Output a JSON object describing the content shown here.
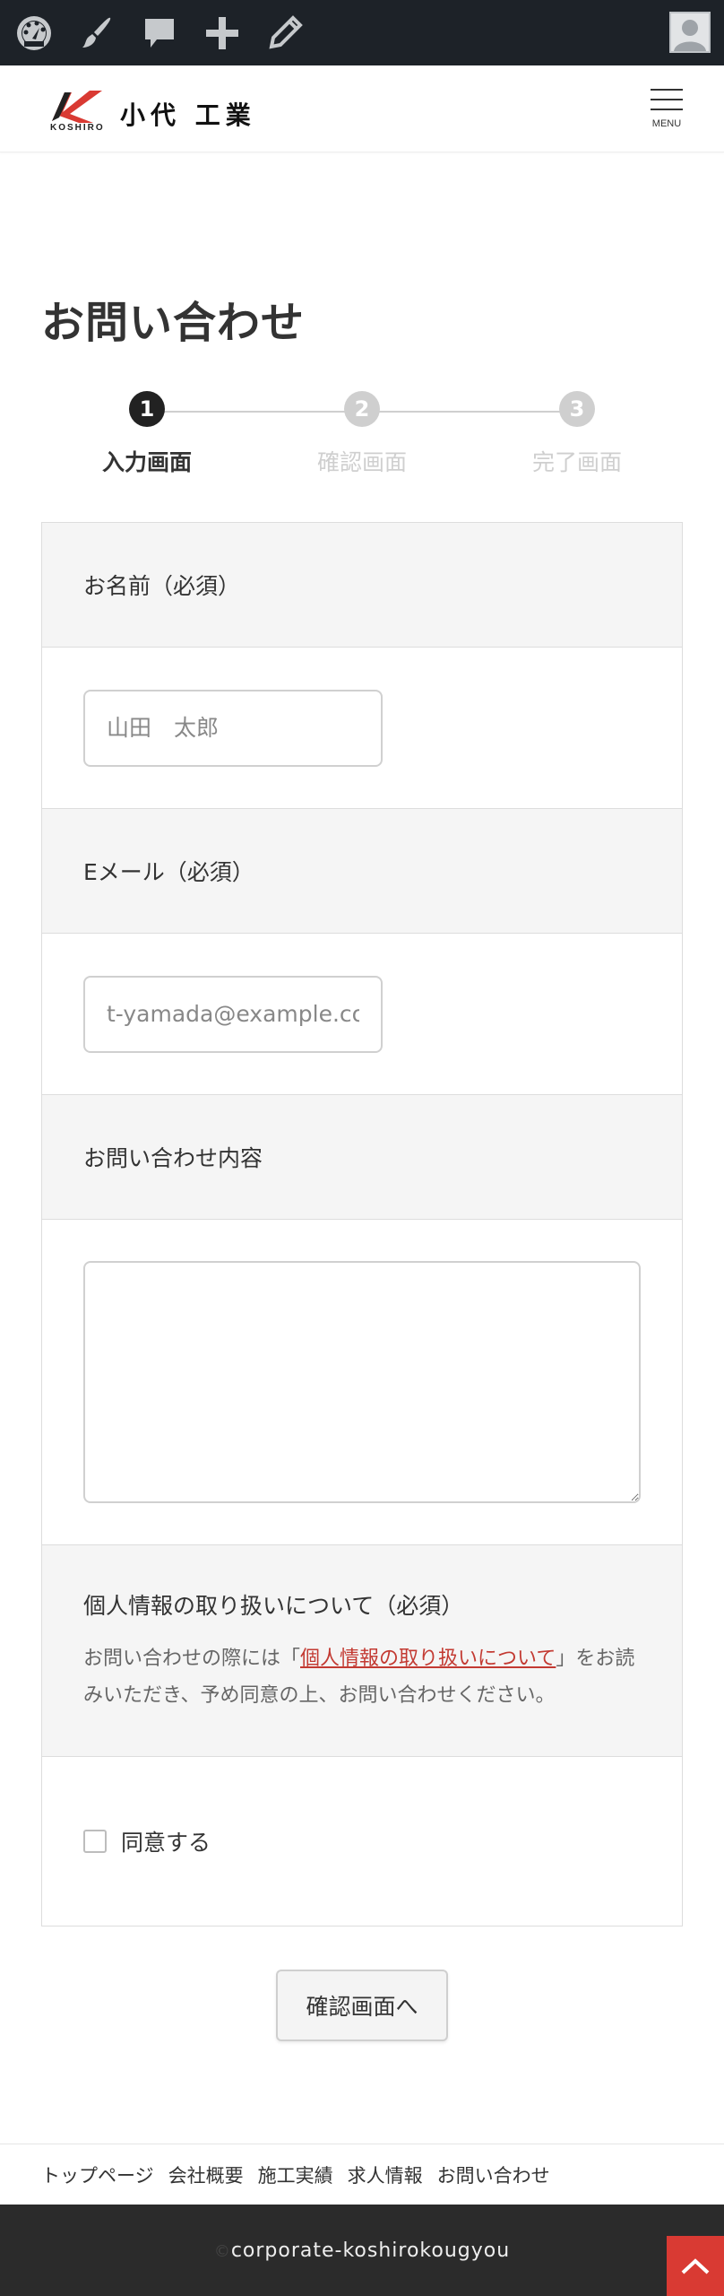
{
  "adminbar": {
    "icons": [
      "dashboard-icon",
      "customize-brush-icon",
      "comments-icon",
      "new-content-plus-icon",
      "edit-pencil-icon"
    ],
    "avatar": "user-avatar"
  },
  "header": {
    "logo_text": "小代 工業",
    "logo_sub": "KOSHIRO",
    "menu_label": "MENU"
  },
  "page": {
    "title": "お問い合わせ"
  },
  "steps": [
    {
      "num": "1",
      "label": "入力画面",
      "active": true
    },
    {
      "num": "2",
      "label": "確認画面",
      "active": false
    },
    {
      "num": "3",
      "label": "完了画面",
      "active": false
    }
  ],
  "form": {
    "name_label": "お名前（必須）",
    "name_placeholder": "山田　太郎",
    "email_label": "Eメール（必須）",
    "email_placeholder": "t-yamada@example.co.jp",
    "message_label": "お問い合わせ内容",
    "message_value": "",
    "privacy_title": "個人情報の取り扱いについて（必須）",
    "privacy_note_before": "お問い合わせの際には「",
    "privacy_link": "個人情報の取り扱いについて",
    "privacy_note_after": "」をお読みいただき、予め同意の上、お問い合わせください。",
    "consent_label": "同意する",
    "consent_checked": false,
    "submit_label": "確認画面へ"
  },
  "footer_nav": [
    "トップページ",
    "会社概要",
    "施工実績",
    "求人情報",
    "お問い合わせ"
  ],
  "footer": {
    "copyright_symbol": "©",
    "copyright": "corporate-koshirokougyou"
  },
  "colors": {
    "accent_red": "#d93a33",
    "link_red": "#c33a32",
    "adminbar_bg": "#1d2228",
    "footer_bg": "#2b2b2b"
  }
}
